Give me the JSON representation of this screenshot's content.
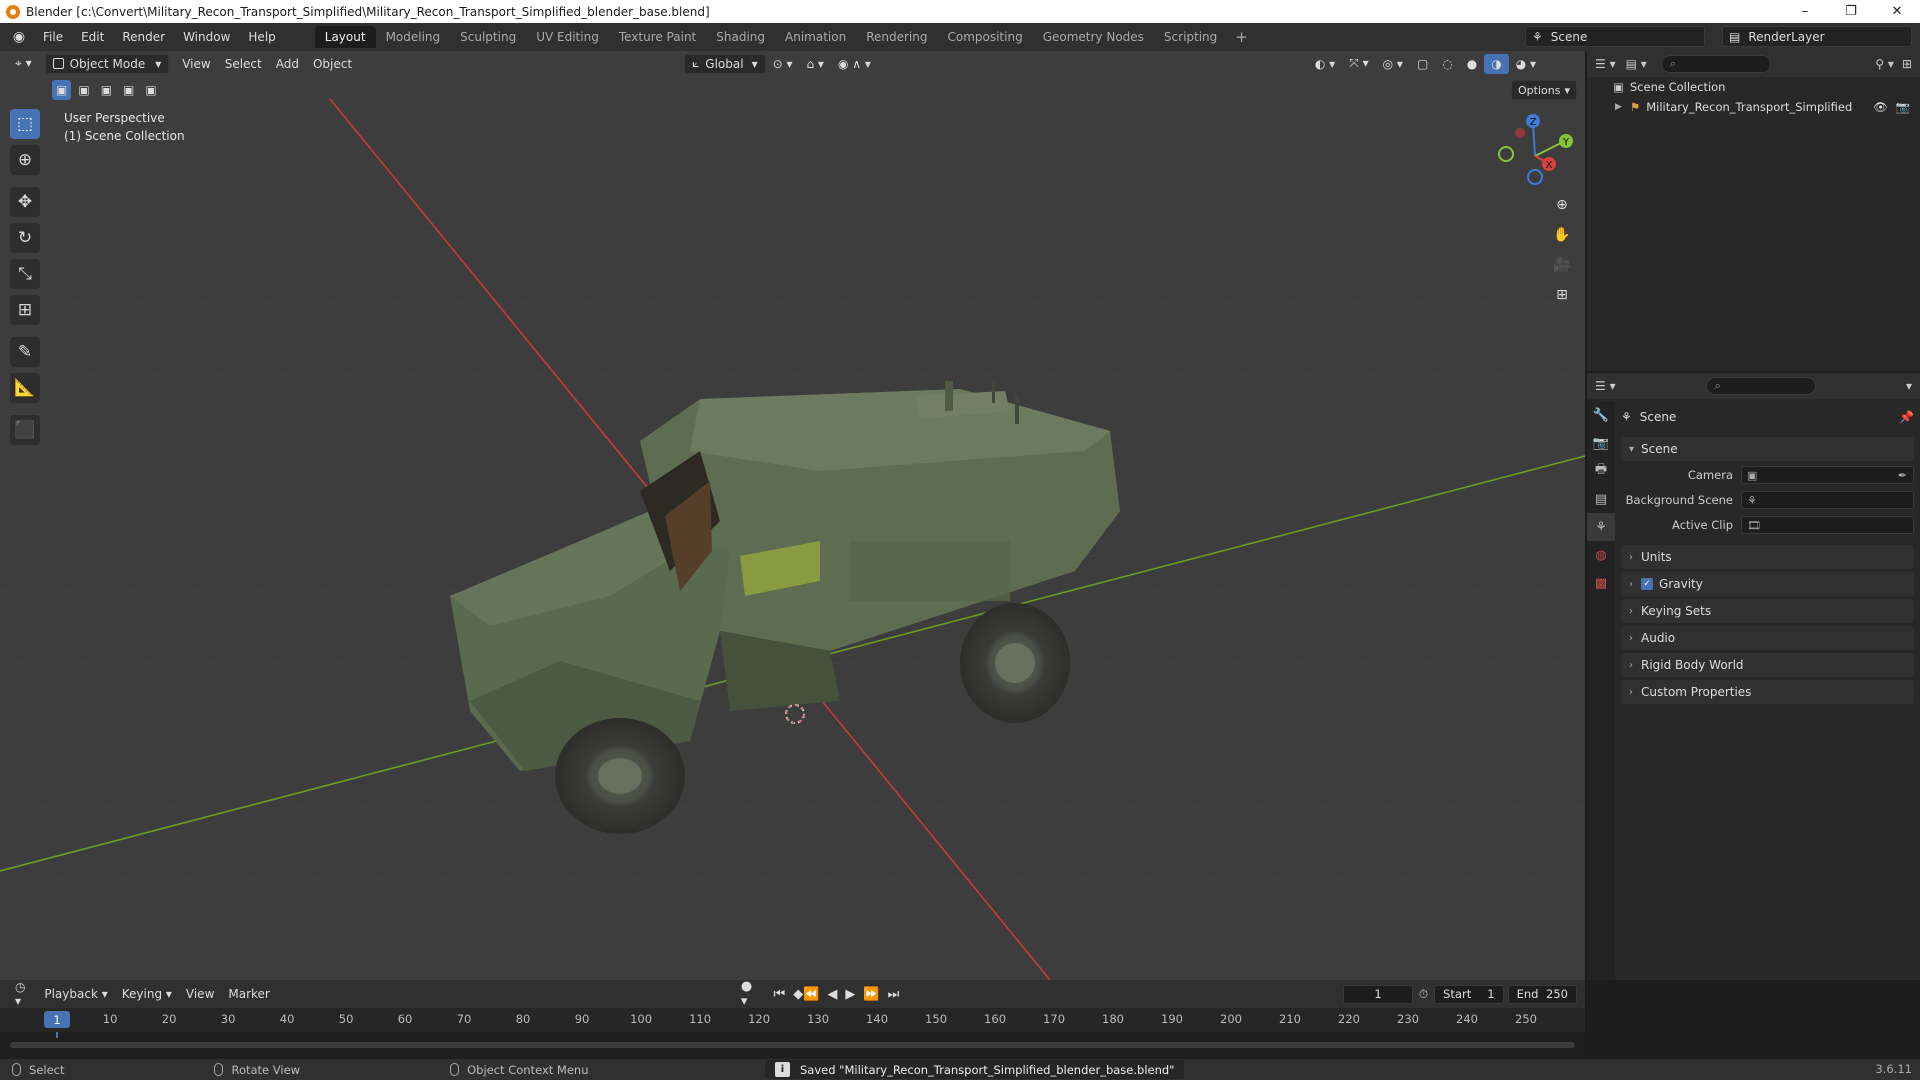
{
  "window": {
    "title": "Blender [c:\\Convert\\Military_Recon_Transport_Simplified\\Military_Recon_Transport_Simplified_blender_base.blend]",
    "minimize": "–",
    "maximize": "❐",
    "close": "✕"
  },
  "menus": [
    "File",
    "Edit",
    "Render",
    "Window",
    "Help"
  ],
  "workspaces": [
    {
      "label": "Layout",
      "active": true
    },
    {
      "label": "Modeling"
    },
    {
      "label": "Sculpting"
    },
    {
      "label": "UV Editing"
    },
    {
      "label": "Texture Paint"
    },
    {
      "label": "Shading"
    },
    {
      "label": "Animation"
    },
    {
      "label": "Rendering"
    },
    {
      "label": "Compositing"
    },
    {
      "label": "Geometry Nodes"
    },
    {
      "label": "Scripting"
    }
  ],
  "workspace_add": "+",
  "scene_name": "Scene",
  "view_layer": "RenderLayer",
  "viewport": {
    "mode": "Object Mode",
    "menus": [
      "View",
      "Select",
      "Add",
      "Object"
    ],
    "orientation": "Global",
    "options_label": "Options",
    "perspective": "User Perspective",
    "collection": "(1) Scene Collection",
    "axes": {
      "x": "X",
      "y": "Y",
      "z": "Z"
    },
    "colors": {
      "background": "#3d3d3d",
      "x_axis": "#c9393f",
      "y_axis": "#6d9b26",
      "vehicle": "#5a6a4c"
    }
  },
  "outliner": {
    "root": "Scene Collection",
    "items": [
      {
        "label": "Military_Recon_Transport_Simplified"
      }
    ]
  },
  "properties": {
    "context": "Scene",
    "section": "Scene",
    "fields": [
      {
        "label": "Camera",
        "value": ""
      },
      {
        "label": "Background Scene",
        "value": ""
      },
      {
        "label": "Active Clip",
        "value": ""
      }
    ],
    "collapsed": [
      {
        "label": "Units",
        "checkbox": false
      },
      {
        "label": "Gravity",
        "checkbox": true
      },
      {
        "label": "Keying Sets",
        "checkbox": false
      },
      {
        "label": "Audio",
        "checkbox": false
      },
      {
        "label": "Rigid Body World",
        "checkbox": false
      },
      {
        "label": "Custom Properties",
        "checkbox": false
      }
    ]
  },
  "timeline": {
    "menus": [
      "Playback",
      "Keying",
      "View",
      "Marker"
    ],
    "current_frame": "1",
    "start_label": "Start",
    "start": "1",
    "end_label": "End",
    "end": "250",
    "ticks": [
      "10",
      "20",
      "30",
      "40",
      "50",
      "60",
      "70",
      "80",
      "90",
      "100",
      "110",
      "120",
      "130",
      "140",
      "150",
      "160",
      "170",
      "180",
      "190",
      "200",
      "210",
      "220",
      "230",
      "240",
      "250"
    ]
  },
  "statusbar": {
    "select": "Select",
    "rotate": "Rotate View",
    "context_menu": "Object Context Menu",
    "message": "Saved \"Military_Recon_Transport_Simplified_blender_base.blend\"",
    "version": "3.6.11"
  }
}
